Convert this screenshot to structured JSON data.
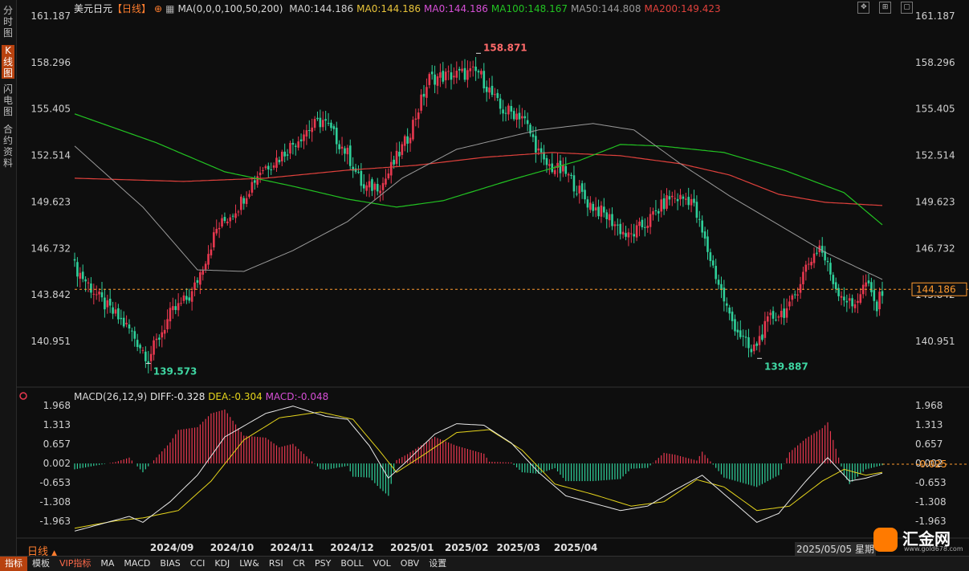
{
  "sidebar": {
    "tabs": [
      {
        "label": "分时图",
        "active": false
      },
      {
        "label": "K线图",
        "active": true
      },
      {
        "label": "闪电图",
        "active": false
      },
      {
        "label": "合约资料",
        "active": false
      }
    ]
  },
  "header": {
    "symbol": "美元日元",
    "period_tag": "【日线】",
    "ma_params": "MA(0,0,0,100,50,200)",
    "ma_items": [
      {
        "text": "MA0:144.186",
        "color": "#d0d0d0"
      },
      {
        "text": "MA0:144.186",
        "color": "#e8c43a"
      },
      {
        "text": "MA0:144.186",
        "color": "#d64fd6"
      },
      {
        "text": "MA100:148.167",
        "color": "#22c322"
      },
      {
        "text": "MA50:144.808",
        "color": "#9a9a9a"
      },
      {
        "text": "MA200:149.423",
        "color": "#e0413c"
      }
    ]
  },
  "macd_header": {
    "params": "MACD(26,12,9)",
    "diff": "DIFF:-0.328",
    "dea": "DEA:-0.304",
    "macd": "MACD:-0.048"
  },
  "footer": {
    "period": "日线",
    "date": "2025/05/05 星期",
    "tabs": [
      "指标",
      "模板",
      "VIP指标",
      "MA",
      "MACD",
      "BIAS",
      "CCI",
      "KDJ",
      "LW&",
      "RSI",
      "CR",
      "PSY",
      "BOLL",
      "VOL",
      "OBV",
      "设置"
    ],
    "active_tab": "指标",
    "logo_text": "汇金网",
    "logo_sub": "www.gold678.com"
  },
  "chart_data": [
    {
      "type": "candlestick",
      "title": "美元日元",
      "period": "日线",
      "y_ticks": [
        "161.187",
        "158.296",
        "155.405",
        "152.514",
        "149.623",
        "146.732",
        "143.842",
        "140.951"
      ],
      "ylim": [
        139.5,
        161.6
      ],
      "x_ticks": [
        "2024/09",
        "2024/10",
        "2024/11",
        "2024/12",
        "2025/01",
        "2025/02",
        "2025/03",
        "2025/04"
      ],
      "current_price": "144.186",
      "annotations": [
        {
          "text": "158.871",
          "type": "high"
        },
        {
          "text": "139.573",
          "type": "low"
        },
        {
          "text": "139.887",
          "type": "low"
        }
      ],
      "colors": {
        "up": "#e8384f",
        "down": "#2fd09a",
        "ma50": "#9a9a9a",
        "ma100": "#22c322",
        "ma200": "#e0413c"
      },
      "close_path": [
        {
          "i": 0,
          "v": 145.6
        },
        {
          "i": 10,
          "v": 143.4
        },
        {
          "i": 20,
          "v": 141.7
        },
        {
          "i": 27,
          "v": 139.9
        },
        {
          "i": 35,
          "v": 142.6
        },
        {
          "i": 43,
          "v": 143.9
        },
        {
          "i": 52,
          "v": 147.9
        },
        {
          "i": 60,
          "v": 149.4
        },
        {
          "i": 68,
          "v": 151.6
        },
        {
          "i": 75,
          "v": 152.4
        },
        {
          "i": 85,
          "v": 154.1
        },
        {
          "i": 91,
          "v": 154.7
        },
        {
          "i": 100,
          "v": 152.6
        },
        {
          "i": 106,
          "v": 150.4
        },
        {
          "i": 113,
          "v": 150.8
        },
        {
          "i": 122,
          "v": 153.6
        },
        {
          "i": 130,
          "v": 157.3
        },
        {
          "i": 138,
          "v": 157.5
        },
        {
          "i": 148,
          "v": 157.7
        },
        {
          "i": 156,
          "v": 155.4
        },
        {
          "i": 164,
          "v": 155.0
        },
        {
          "i": 172,
          "v": 152.0
        },
        {
          "i": 180,
          "v": 151.4
        },
        {
          "i": 188,
          "v": 149.6
        },
        {
          "i": 196,
          "v": 148.6
        },
        {
          "i": 203,
          "v": 147.4
        },
        {
          "i": 210,
          "v": 148.4
        },
        {
          "i": 218,
          "v": 149.9
        },
        {
          "i": 226,
          "v": 149.8
        },
        {
          "i": 232,
          "v": 146.6
        },
        {
          "i": 240,
          "v": 142.5
        },
        {
          "i": 248,
          "v": 140.2
        },
        {
          "i": 255,
          "v": 142.4
        },
        {
          "i": 262,
          "v": 143.0
        },
        {
          "i": 268,
          "v": 145.6
        },
        {
          "i": 273,
          "v": 146.9
        },
        {
          "i": 279,
          "v": 144.3
        },
        {
          "i": 285,
          "v": 143.1
        },
        {
          "i": 290,
          "v": 144.6
        },
        {
          "i": 294,
          "v": 143.0
        },
        {
          "i": 296,
          "v": 144.2
        }
      ],
      "ma50": [
        {
          "i": 0,
          "v": 153.1
        },
        {
          "i": 25,
          "v": 149.3
        },
        {
          "i": 45,
          "v": 145.4
        },
        {
          "i": 62,
          "v": 145.3
        },
        {
          "i": 80,
          "v": 146.6
        },
        {
          "i": 100,
          "v": 148.4
        },
        {
          "i": 120,
          "v": 151.1
        },
        {
          "i": 140,
          "v": 152.9
        },
        {
          "i": 170,
          "v": 154.1
        },
        {
          "i": 190,
          "v": 154.5
        },
        {
          "i": 205,
          "v": 154.1
        },
        {
          "i": 222,
          "v": 152.0
        },
        {
          "i": 240,
          "v": 150.0
        },
        {
          "i": 258,
          "v": 148.2
        },
        {
          "i": 275,
          "v": 146.5
        },
        {
          "i": 296,
          "v": 144.8
        }
      ],
      "ma100": [
        {
          "i": 0,
          "v": 155.1
        },
        {
          "i": 30,
          "v": 153.3
        },
        {
          "i": 55,
          "v": 151.5
        },
        {
          "i": 80,
          "v": 150.6
        },
        {
          "i": 100,
          "v": 149.8
        },
        {
          "i": 118,
          "v": 149.3
        },
        {
          "i": 135,
          "v": 149.7
        },
        {
          "i": 160,
          "v": 151.0
        },
        {
          "i": 185,
          "v": 152.2
        },
        {
          "i": 200,
          "v": 153.2
        },
        {
          "i": 215,
          "v": 153.1
        },
        {
          "i": 238,
          "v": 152.7
        },
        {
          "i": 260,
          "v": 151.6
        },
        {
          "i": 282,
          "v": 150.2
        },
        {
          "i": 296,
          "v": 148.2
        }
      ],
      "ma200": [
        {
          "i": 0,
          "v": 151.1
        },
        {
          "i": 40,
          "v": 150.9
        },
        {
          "i": 70,
          "v": 151.1
        },
        {
          "i": 100,
          "v": 151.6
        },
        {
          "i": 125,
          "v": 151.9
        },
        {
          "i": 150,
          "v": 152.4
        },
        {
          "i": 175,
          "v": 152.7
        },
        {
          "i": 200,
          "v": 152.5
        },
        {
          "i": 222,
          "v": 152.0
        },
        {
          "i": 240,
          "v": 151.3
        },
        {
          "i": 258,
          "v": 150.1
        },
        {
          "i": 275,
          "v": 149.6
        },
        {
          "i": 296,
          "v": 149.4
        }
      ]
    },
    {
      "type": "macd",
      "title": "MACD(26,12,9)",
      "y_ticks": [
        "1.968",
        "1.313",
        "0.657",
        "0.002",
        "-0.653",
        "-1.308",
        "-1.963"
      ],
      "ylim": [
        -2.35,
        2.05
      ],
      "current_value": "-0.025",
      "colors": {
        "diff": "#e8e8e8",
        "dea": "#e5d41c",
        "hist_up": "#e8384f",
        "hist_down": "#2fd09a"
      },
      "diff": [
        {
          "i": 0,
          "v": -2.3
        },
        {
          "i": 10,
          "v": -2.05
        },
        {
          "i": 20,
          "v": -1.8
        },
        {
          "i": 25,
          "v": -2.0
        },
        {
          "i": 35,
          "v": -1.3
        },
        {
          "i": 45,
          "v": -0.4
        },
        {
          "i": 55,
          "v": 0.9
        },
        {
          "i": 70,
          "v": 1.7
        },
        {
          "i": 80,
          "v": 1.95
        },
        {
          "i": 92,
          "v": 1.6
        },
        {
          "i": 100,
          "v": 1.5
        },
        {
          "i": 108,
          "v": 0.6
        },
        {
          "i": 115,
          "v": -0.5
        },
        {
          "i": 122,
          "v": 0.1
        },
        {
          "i": 132,
          "v": 1.0
        },
        {
          "i": 140,
          "v": 1.35
        },
        {
          "i": 150,
          "v": 1.3
        },
        {
          "i": 160,
          "v": 0.7
        },
        {
          "i": 170,
          "v": -0.3
        },
        {
          "i": 180,
          "v": -1.1
        },
        {
          "i": 192,
          "v": -1.4
        },
        {
          "i": 200,
          "v": -1.6
        },
        {
          "i": 210,
          "v": -1.45
        },
        {
          "i": 220,
          "v": -0.9
        },
        {
          "i": 230,
          "v": -0.4
        },
        {
          "i": 240,
          "v": -1.2
        },
        {
          "i": 250,
          "v": -2.0
        },
        {
          "i": 258,
          "v": -1.7
        },
        {
          "i": 268,
          "v": -0.6
        },
        {
          "i": 276,
          "v": 0.2
        },
        {
          "i": 284,
          "v": -0.6
        },
        {
          "i": 290,
          "v": -0.5
        },
        {
          "i": 296,
          "v": -0.33
        }
      ],
      "dea": [
        {
          "i": 0,
          "v": -2.2
        },
        {
          "i": 15,
          "v": -1.95
        },
        {
          "i": 25,
          "v": -1.85
        },
        {
          "i": 38,
          "v": -1.6
        },
        {
          "i": 50,
          "v": -0.6
        },
        {
          "i": 62,
          "v": 0.8
        },
        {
          "i": 75,
          "v": 1.55
        },
        {
          "i": 90,
          "v": 1.75
        },
        {
          "i": 102,
          "v": 1.5
        },
        {
          "i": 112,
          "v": 0.4
        },
        {
          "i": 118,
          "v": -0.3
        },
        {
          "i": 128,
          "v": 0.3
        },
        {
          "i": 140,
          "v": 1.05
        },
        {
          "i": 152,
          "v": 1.15
        },
        {
          "i": 164,
          "v": 0.45
        },
        {
          "i": 176,
          "v": -0.7
        },
        {
          "i": 190,
          "v": -1.05
        },
        {
          "i": 204,
          "v": -1.45
        },
        {
          "i": 216,
          "v": -1.3
        },
        {
          "i": 228,
          "v": -0.55
        },
        {
          "i": 238,
          "v": -0.8
        },
        {
          "i": 250,
          "v": -1.6
        },
        {
          "i": 262,
          "v": -1.45
        },
        {
          "i": 274,
          "v": -0.6
        },
        {
          "i": 282,
          "v": -0.2
        },
        {
          "i": 290,
          "v": -0.4
        },
        {
          "i": 296,
          "v": -0.3
        }
      ]
    }
  ]
}
